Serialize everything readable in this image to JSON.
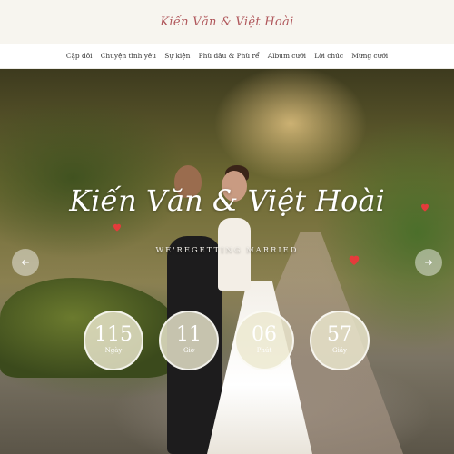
{
  "header": {
    "logo_text": "Kiến Văn & Việt Hoài"
  },
  "nav": {
    "items": [
      {
        "label": "Cặp đôi"
      },
      {
        "label": "Chuyện tình yêu"
      },
      {
        "label": "Sự kiện"
      },
      {
        "label": "Phù dâu & Phù rể"
      },
      {
        "label": "Album cưới"
      },
      {
        "label": "Lời chúc"
      },
      {
        "label": "Mừng cưới"
      }
    ]
  },
  "hero": {
    "title": "Kiến Văn & Việt Hoài",
    "subtitle": "WE'REGETTING MARRIED",
    "prev_icon": "arrow-left-icon",
    "next_icon": "arrow-right-icon",
    "heart_color": "#e53b3b"
  },
  "countdown": {
    "items": [
      {
        "value": "115",
        "label": "Ngày"
      },
      {
        "value": "11",
        "label": "Giờ"
      },
      {
        "value": "06",
        "label": "Phút"
      },
      {
        "value": "57",
        "label": "Giây"
      }
    ]
  },
  "colors": {
    "logo": "#b0575b",
    "topbar_bg": "#f7f5ef",
    "nav_bg": "#ffffff"
  }
}
